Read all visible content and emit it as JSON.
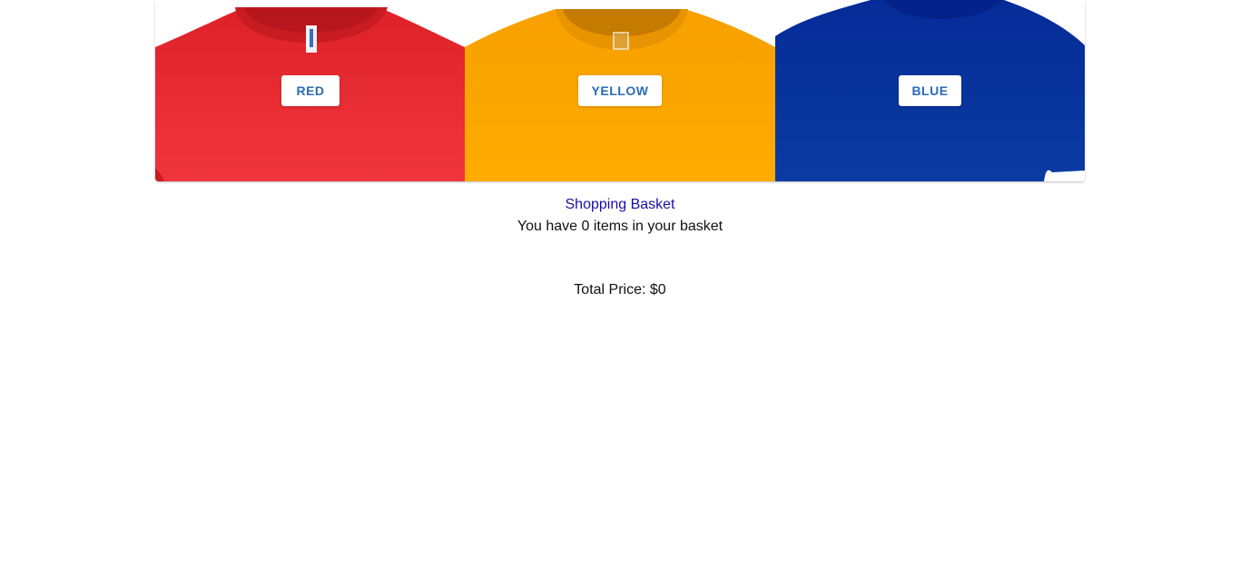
{
  "products": [
    {
      "label": "RED",
      "shirt_color": "#e8262e",
      "collar_color": "#d51f27"
    },
    {
      "label": "YELLOW",
      "shirt_color": "#ffa500",
      "collar_color": "#f39a00"
    },
    {
      "label": "BLUE",
      "shirt_color": "#0a2e9c",
      "collar_color": "#052787"
    }
  ],
  "basket": {
    "link_label": "Shopping Basket",
    "count_text": "You have 0 items in your basket",
    "total_text": "Total Price: $0"
  },
  "colors": {
    "button_text": "#2b6cb8",
    "link": "#1a0dab"
  }
}
